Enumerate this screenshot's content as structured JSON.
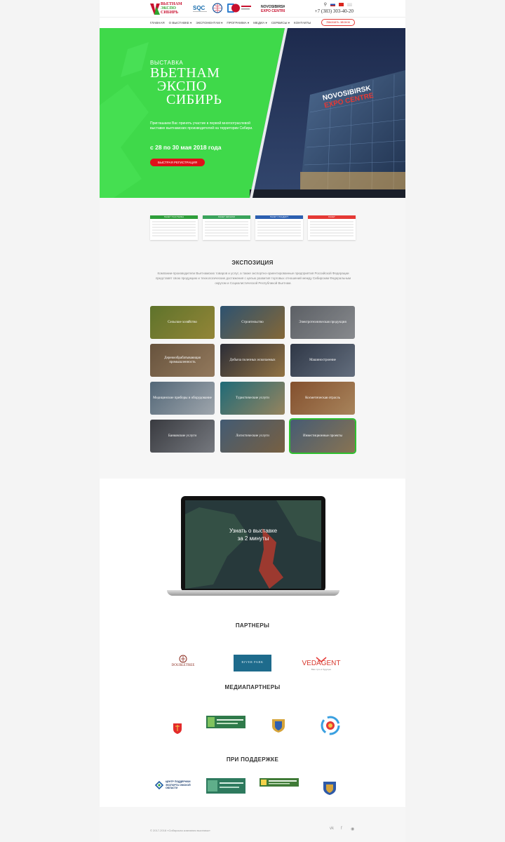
{
  "header": {
    "logo_lines": [
      "ВЬЕТНАМ",
      "ЭКСПО",
      "СИБИРЬ"
    ],
    "phone": "+7 (383) 303-40-20",
    "partner_logo_text": "NOVOSIBIRSK EXPO CENTRE"
  },
  "nav": {
    "items": [
      "Главная",
      "О выставке",
      "Экспонентам",
      "Программа",
      "Медиа",
      "Сервисы",
      "Контакты"
    ],
    "callback": "Заказать звонок"
  },
  "hero": {
    "kicker": "ВЫСТАВКА",
    "title": [
      "ВЬЕТНАМ",
      "ЭКСПО",
      "СИБИРЬ"
    ],
    "description": "Приглашаем Вас принять участие в первой многоотраслевой выставке вьетнамских производителей на территории Сибири.",
    "date": "с 28 по 30 мая 2018 года",
    "button": "Быстрая регистрация",
    "building_sign": [
      "NOVOSIBIRSK",
      "EXPO CENTRE"
    ]
  },
  "tickets": [
    {
      "label": "ПАКЕТ УЧАСТНИКА",
      "color": "#2e9e3a"
    },
    {
      "label": "ПАКЕТ ЭКОНОМ",
      "color": "#3aa35b"
    },
    {
      "label": "ПАКЕТ СТАНДАРТ",
      "color": "#2c5fb0"
    },
    {
      "label": "ПАКЕТ",
      "color": "#e53935"
    }
  ],
  "exposition": {
    "title": "ЭКСПОЗИЦИЯ",
    "text": "Компании-производители Вьетнамских товаров и услуг, а также экспортно-ориентированные предприятия Российской Федерации представят свою продукцию и технологические достижения с целью развития торговых отношений между Сибирским Федеральным округом и Социалистической Республикой Вьетнам.",
    "tiles": [
      {
        "label": "Сельское хозяйство",
        "colors": [
          "#7e9a3a",
          "#c5b24a"
        ]
      },
      {
        "label": "Строительство",
        "colors": [
          "#3d6e96",
          "#b08a4a"
        ]
      },
      {
        "label": "Электротехническая продукция",
        "colors": [
          "#7b8087",
          "#b5b8bd"
        ]
      },
      {
        "label": "Деревообрабатывающая промышленность",
        "colors": [
          "#8a6f52",
          "#c4a27c"
        ]
      },
      {
        "label": "Добыча полезных ископаемых",
        "colors": [
          "#3b3d4a",
          "#c49a5a"
        ]
      },
      {
        "label": "Машиностроение",
        "colors": [
          "#3f4a5e",
          "#8593a8"
        ]
      },
      {
        "label": "Медицинские приборы и оборудование",
        "colors": [
          "#6f8aa0",
          "#d4dde6"
        ]
      },
      {
        "label": "Туристические услуги",
        "colors": [
          "#2a8ea0",
          "#c9b07d"
        ]
      },
      {
        "label": "Косметическая отрасль",
        "colors": [
          "#b06b3e",
          "#e0b07a"
        ]
      },
      {
        "label": "Банковские услуги",
        "colors": [
          "#4d4f56",
          "#9da1a9"
        ]
      },
      {
        "label": "Логистические услуги",
        "colors": [
          "#5a7a9a",
          "#a08058"
        ]
      },
      {
        "label": "Инвестиционные проекты",
        "colors": [
          "#5e7b9a",
          "#b69a6e"
        ]
      }
    ]
  },
  "video": {
    "line1": "Узнать о выставке",
    "line2": "за 2 минуты"
  },
  "partners": {
    "title": "ПАРТНЕРЫ",
    "items": [
      "DOUBLETREE",
      "RIVER PARK",
      "VEDAGENT"
    ],
    "vedagent_sub": "Ваш путь в будущее"
  },
  "media": {
    "title": "МЕДИАПАРТНЕРЫ"
  },
  "support": {
    "title": "ПРИ ПОДДЕРЖКЕ",
    "items": [
      "ЦЕНТР ПОДДЕРЖКИ ЭКСПОРТА ОМСКОЙ ОБЛАСТИ"
    ]
  },
  "footer": {
    "copyright": "© 2017-2018 «Сибирская компания выставок»"
  }
}
